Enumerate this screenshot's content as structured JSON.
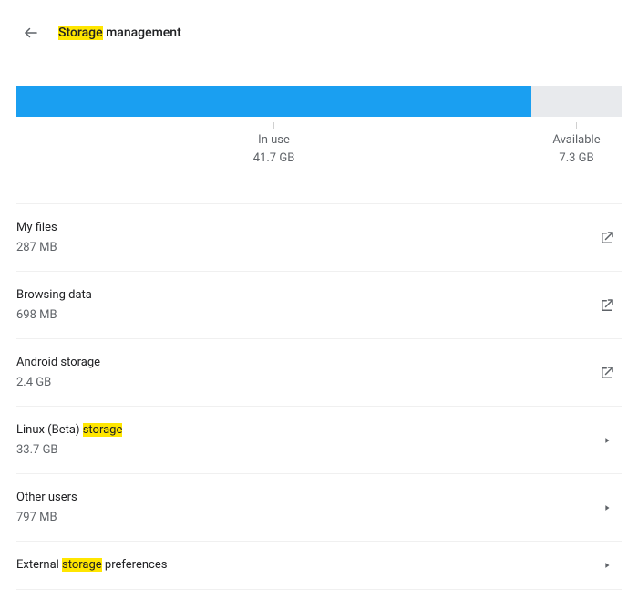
{
  "header": {
    "title_pre": "",
    "title_highlight": "Storage",
    "title_post": " management"
  },
  "storage": {
    "in_use_label": "In use",
    "in_use_value": "41.7 GB",
    "available_label": "Available",
    "available_value": "7.3 GB",
    "used_percent": 85.1
  },
  "rows": [
    {
      "title_pre": "My files",
      "title_hl": "",
      "title_post": "",
      "sub": "287 MB",
      "icon": "external"
    },
    {
      "title_pre": "Browsing data",
      "title_hl": "",
      "title_post": "",
      "sub": "698 MB",
      "icon": "external"
    },
    {
      "title_pre": "Android storage",
      "title_hl": "",
      "title_post": "",
      "sub": "2.4 GB",
      "icon": "external"
    },
    {
      "title_pre": "Linux (Beta) ",
      "title_hl": "storage",
      "title_post": "",
      "sub": "33.7 GB",
      "icon": "arrow"
    },
    {
      "title_pre": "Other users",
      "title_hl": "",
      "title_post": "",
      "sub": "797 MB",
      "icon": "arrow"
    },
    {
      "title_pre": "External ",
      "title_hl": "storage",
      "title_post": " preferences",
      "sub": "",
      "icon": "arrow"
    }
  ]
}
